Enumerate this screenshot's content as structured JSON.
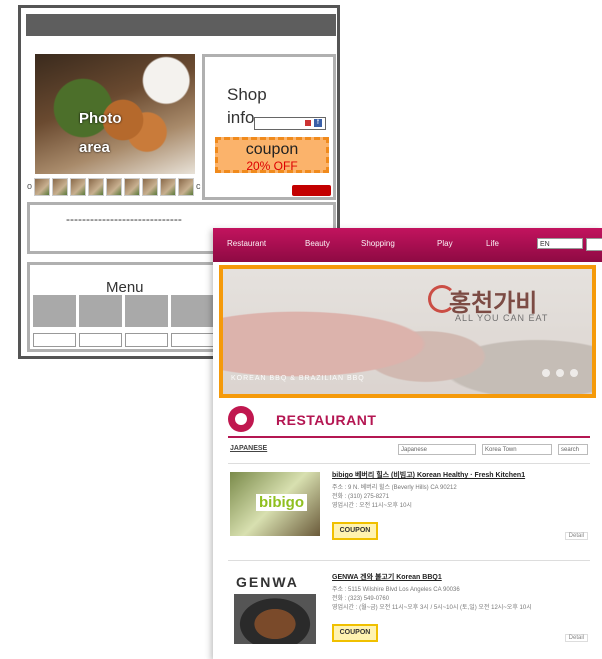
{
  "wireframe": {
    "photo_label_line1": "Photo",
    "photo_label_line2": "area",
    "shop_title": "Shop info",
    "sns_icon_label": "f",
    "coupon_title": "coupon",
    "coupon_discount": "20% OFF",
    "description_line": "-----------------------------",
    "menu_title": "Menu",
    "thumb_more": "c"
  },
  "website": {
    "nav": [
      "Restaurant",
      "Beauty",
      "Shopping",
      "Play",
      "Life"
    ],
    "nav_select": "EN",
    "banner_logo": "홍천가비",
    "banner_tagline": "ALL YOU CAN EAT",
    "banner_caption": "KOREAN BBQ & BRAZILIAN BBQ",
    "section_title": "RESTAURANT",
    "filter_label": "JAPANESE",
    "filter_select_1": "Japanese",
    "filter_select_2": "Korea Town",
    "filter_button": "search",
    "listings": [
      {
        "name": "bibigo 베버리 힐스 (비빔고) Korean Healthy · Fresh Kitchen1",
        "logo": "bibigo",
        "lines": [
          "주소 : 9 N. 베버리 힐스 (Beverly Hills) CA 90212",
          "전화 : (310) 275-8271",
          "영업시간 : 오전 11시~오후 10시"
        ],
        "coupon": "COUPON",
        "detail": "Detail"
      },
      {
        "name": "GENWA 겐와 불고기 Korean BBQ1",
        "logo": "GENWA",
        "lines": [
          "주소 : 5115 Wilshire Blvd Los Angeles CA 90036",
          "전화 : (323) 549-0760",
          "영업시간 : (월~금) 오전 11시~오후 3시 / 5시~10시 (토,일) 오전 12시~오후 10시"
        ],
        "coupon": "COUPON",
        "detail": "Detail"
      }
    ]
  }
}
